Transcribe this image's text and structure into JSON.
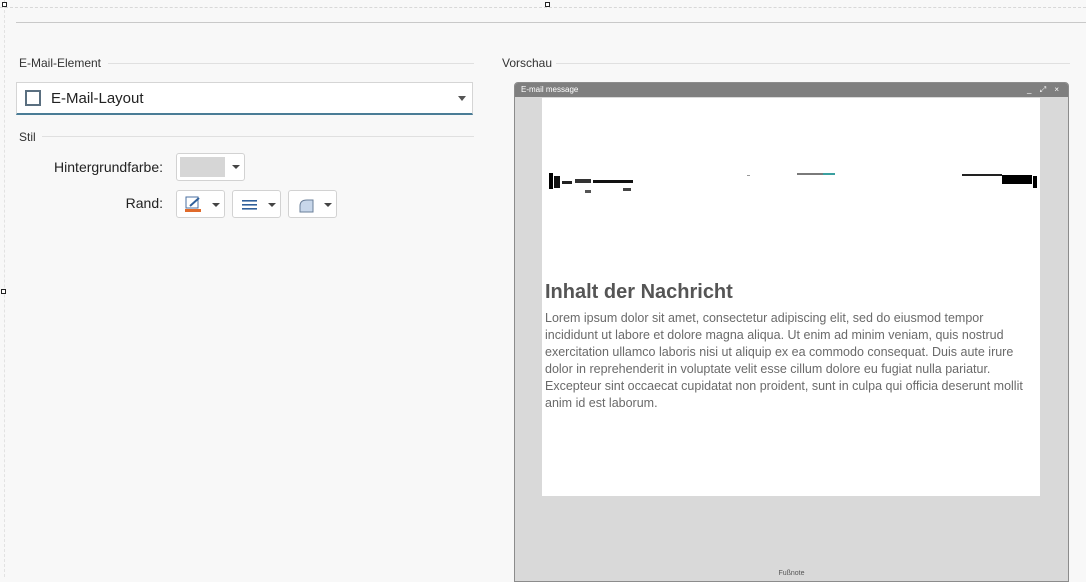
{
  "sections": {
    "element": "E-Mail-Element",
    "style": "Stil",
    "preview": "Vorschau"
  },
  "element_select": {
    "value": "E-Mail-Layout"
  },
  "style": {
    "background_label": "Hintergrundfarbe:",
    "background_color": "#d6d6d6",
    "border_label": "Rand:"
  },
  "preview": {
    "window_title": "E-mail message",
    "window_controls": "_ ⤢ ×",
    "message_title": "Inhalt der Nachricht",
    "message_text": "Lorem ipsum dolor sit amet, consectetur adipiscing elit, sed do eiusmod tempor incididunt ut labore et dolore magna aliqua. Ut enim ad minim veniam, quis nostrud exercitation ullamco laboris nisi ut aliquip ex ea commodo consequat. Duis aute irure dolor in reprehenderit in voluptate velit esse cillum dolore eu fugiat nulla pariatur. Excepteur sint occaecat cupidatat non proident, sunt in culpa qui officia deserunt mollit anim id est laborum.",
    "footer": "Fußnote"
  }
}
